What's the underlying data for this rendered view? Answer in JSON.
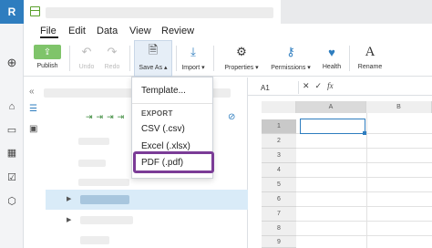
{
  "app": {
    "logo_letter": "R"
  },
  "menu": {
    "items": [
      "File",
      "Edit",
      "Data",
      "View",
      "Review"
    ]
  },
  "ribbon": {
    "publish": "Publish",
    "undo": "Undo",
    "redo": "Redo",
    "save_as": "Save As",
    "import": "Import",
    "properties": "Properties",
    "permissions": "Permissions",
    "health": "Health",
    "rename": "Rename"
  },
  "save_as_menu": {
    "template": "Template...",
    "export_header": "EXPORT",
    "csv": "CSV (.csv)",
    "excel": "Excel (.xlsx)",
    "pdf": "PDF (.pdf)"
  },
  "sheet": {
    "name_box": "A1",
    "columns": [
      "A",
      "B"
    ],
    "rows": [
      "1",
      "2",
      "3",
      "4",
      "5",
      "6",
      "7",
      "8",
      "9"
    ]
  },
  "colors": {
    "accent": "#2e7dbf",
    "highlight": "#7b3c97",
    "publish": "#7fc46a"
  }
}
